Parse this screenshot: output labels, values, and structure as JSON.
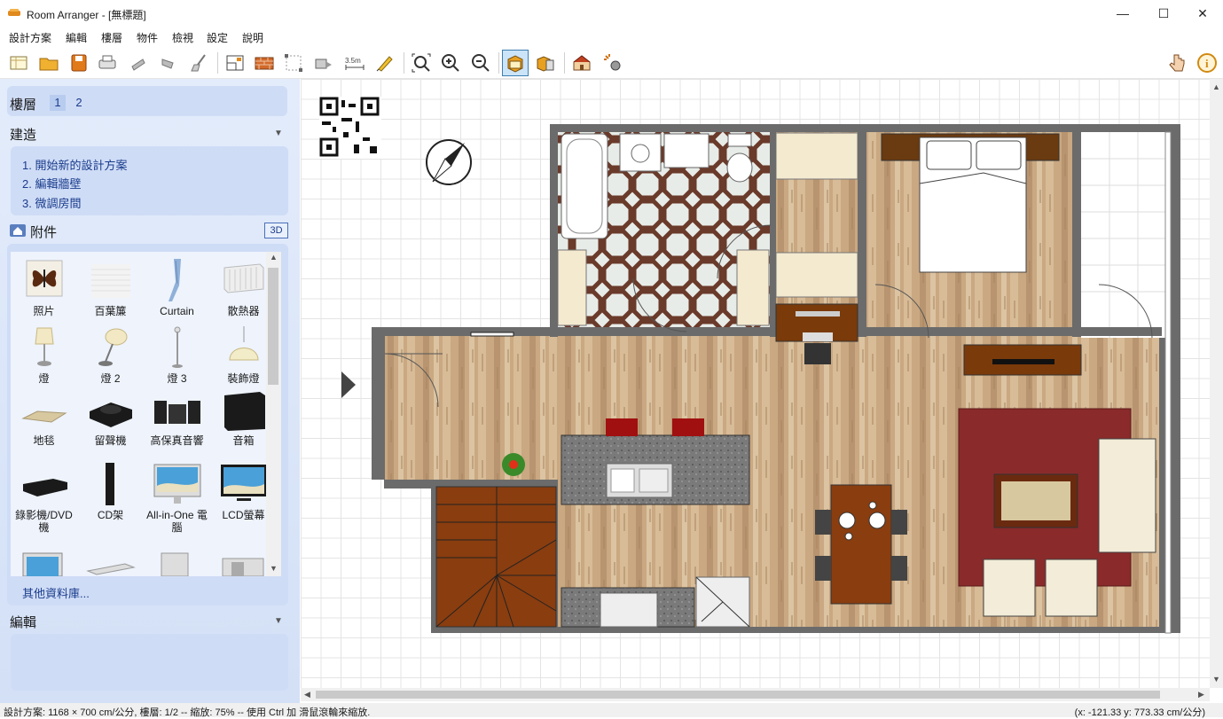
{
  "window": {
    "title": "Room Arranger - [無標題]",
    "minimize": "—",
    "maximize": "☐",
    "close": "✕"
  },
  "menu": [
    "設計方案",
    "編輯",
    "樓層",
    "物件",
    "檢視",
    "設定",
    "說明"
  ],
  "toolbar": {
    "buttons": [
      "new-file-icon",
      "open-folder-icon",
      "save-icon",
      "print-icon",
      "undo-icon",
      "redo-icon",
      "broom-icon",
      "wall-editor-icon",
      "brick-wall-icon",
      "select-corners-icon",
      "move-objects-icon",
      "measure-icon",
      "pencil-icon",
      "zoom-fit-icon",
      "zoom-in-icon",
      "zoom-out-icon",
      "view-2d-icon",
      "view-3d-boxes-icon",
      "house-3d-icon",
      "sparkle-tool-icon"
    ],
    "right": [
      "hand-cursor-icon",
      "info-icon"
    ],
    "measure_label": "3.5m",
    "active": "view-2d-icon"
  },
  "floors": {
    "label": "樓層",
    "items": [
      "1",
      "2"
    ],
    "selected": "1"
  },
  "build": {
    "title": "建造",
    "steps": [
      "1. 開始新的設計方案",
      "2. 編輯牆壁",
      "3. 微調房間"
    ]
  },
  "accessories": {
    "title": "附件",
    "btn_3d": "3D",
    "items": [
      {
        "label": "照片",
        "icon": "butterfly-photo-icon"
      },
      {
        "label": "百葉簾",
        "icon": "blinds-icon"
      },
      {
        "label": "Curtain",
        "icon": "curtain-icon"
      },
      {
        "label": "散熱器",
        "icon": "radiator-icon"
      },
      {
        "label": "燈",
        "icon": "table-lamp-icon"
      },
      {
        "label": "燈 2",
        "icon": "desk-lamp-icon"
      },
      {
        "label": "燈 3",
        "icon": "floor-lamp-icon"
      },
      {
        "label": "裝飾燈",
        "icon": "pendant-lamp-icon"
      },
      {
        "label": "地毯",
        "icon": "rug-icon"
      },
      {
        "label": "留聲機",
        "icon": "turntable-icon"
      },
      {
        "label": "高保真音響",
        "icon": "hifi-icon"
      },
      {
        "label": "音箱",
        "icon": "speaker-icon"
      },
      {
        "label": "錄影機/DVD機",
        "icon": "dvd-player-icon"
      },
      {
        "label": "CD架",
        "icon": "cd-rack-icon"
      },
      {
        "label": "All-in-One 電腦",
        "icon": "all-in-one-pc-icon"
      },
      {
        "label": "LCD螢幕",
        "icon": "lcd-monitor-icon"
      }
    ],
    "more": "其他資料庫..."
  },
  "edit": {
    "title": "編輯"
  },
  "status": {
    "left": "設計方案: 1168 × 700 cm/公分, 樓層: 1/2 -- 縮放: 75% -- 使用 Ctrl 加 滑鼠滾輪來縮放.",
    "right": "(x: -121.33 y: 773.33 cm/公分)"
  },
  "colors": {
    "sidebar": "#dbe6f8",
    "accent": "#1a3c8c",
    "wall": "#6b6b6b",
    "wood": "#c9a57f",
    "carpet": "#8b2a2a",
    "furniture": "#8a3d0f"
  }
}
